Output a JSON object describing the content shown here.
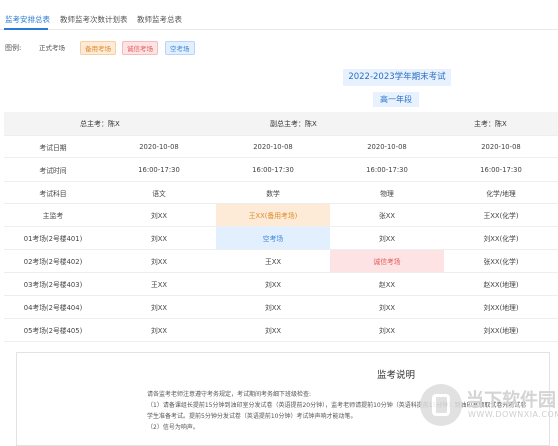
{
  "tabs": [
    "监考安排总表",
    "教师监考次数计划表",
    "教师监考总表"
  ],
  "legend": {
    "label": "图例:",
    "items": [
      "正式考场",
      "备用考场",
      "诚信考场",
      "空考场"
    ]
  },
  "title": "2022-2023学年期末考试",
  "grade": "高一年段",
  "supervisors": {
    "chief": "总主考：陈X",
    "deputy": "副总主考：陈X",
    "main": "主考：陈X"
  },
  "table": {
    "date_label": "考试日期",
    "dates": [
      "2020-10-08",
      "2020-10-08",
      "2020-10-08",
      "2020-10-08"
    ],
    "time_label": "考试时间",
    "times": [
      "16:00-17:30",
      "16:00-17:30",
      "16:00-17:30",
      "16:00-17:30"
    ],
    "subject_label": "考试科目",
    "subjects": [
      "语文",
      "数学",
      "物理",
      "化学/地理"
    ],
    "rows": [
      {
        "room": "主监考",
        "cells": [
          "刘XX",
          "王XX(备用考场)",
          "张XX",
          "王XX(化学)"
        ]
      },
      {
        "room": "01考场(2号楼401)",
        "cells": [
          "刘XX",
          "空考场",
          "刘XX",
          "刘XX(化学)"
        ]
      },
      {
        "room": "02考场(2号楼402)",
        "cells": [
          "刘XX",
          "王XX",
          "诚信考场",
          "张XX(化学)"
        ]
      },
      {
        "room": "03考场(2号楼403)",
        "cells": [
          "王XX",
          "刘XX",
          "赵XX",
          "赵XX(地理)"
        ]
      },
      {
        "room": "04考场(2号楼404)",
        "cells": [
          "刘XX",
          "刘XX",
          "刘XX",
          "刘XX(地理)"
        ]
      },
      {
        "room": "05考场(2号楼405)",
        "cells": [
          "刘XX",
          "刘XX",
          "刘XX",
          "刘XX(地理)"
        ]
      }
    ]
  },
  "notes": {
    "title": "监考说明",
    "lines": [
      "请各监考老师注意遵守考务规定，考试期间考务细下班级检查:",
      "（1）请备课组长提前15分钟到油印室分发试卷（英语提前20分钟），监考老师请提前10分钟（英语科提前15分钟）到油印室领取试卷并将试卷",
      "学生准备考试。提前5分钟分发试卷（英语提前10分钟）考试钟声响才能动笔。",
      "（2）信号为响声。"
    ]
  },
  "watermark": {
    "brand": "当下软件园",
    "domain": "WWW.DOWNXIA.COM"
  }
}
